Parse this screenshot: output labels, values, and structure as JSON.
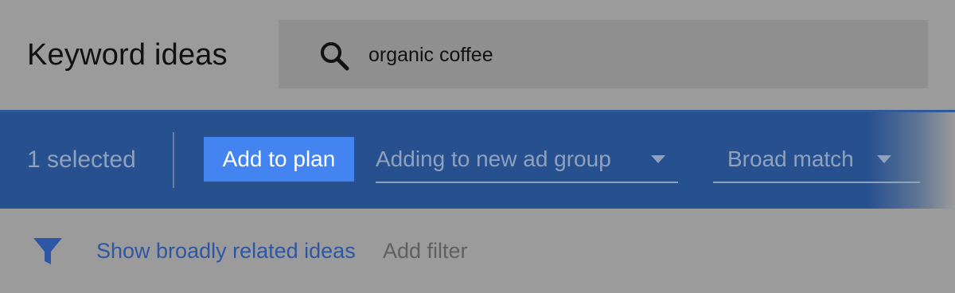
{
  "header": {
    "title": "Keyword ideas",
    "search_query": "organic coffee",
    "search_icon": "search-icon"
  },
  "action_bar": {
    "selected_text": "1 selected",
    "add_button_label": "Add to plan",
    "ad_group_dropdown": "Adding to new ad group",
    "match_type_dropdown": "Broad match",
    "accent_color": "#27508f",
    "button_color": "#4384f0"
  },
  "filter_bar": {
    "filter_icon": "funnel-icon",
    "related_ideas_link": "Show broadly related ideas",
    "add_filter_label": "Add filter"
  }
}
